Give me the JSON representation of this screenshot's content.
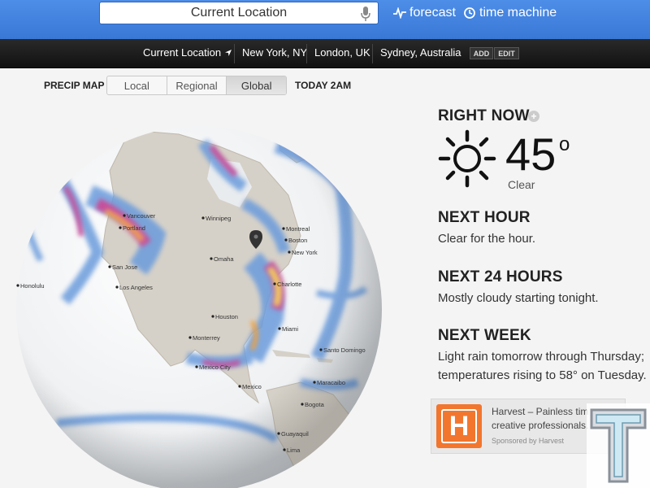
{
  "search": {
    "value": "Current Location"
  },
  "nav": {
    "forecast": "forecast",
    "time_machine": "time machine"
  },
  "locations": {
    "items": [
      "Current Location",
      "New York, NY",
      "London, UK",
      "Sydney, Australia"
    ],
    "add": "ADD",
    "edit": "EDIT"
  },
  "precip": {
    "label": "PRECIP MAP",
    "tabs": [
      "Local",
      "Regional",
      "Global"
    ],
    "active": "Global",
    "time": "TODAY 2AM"
  },
  "map": {
    "cities": [
      "Vancouver",
      "Portland",
      "Winnipeg",
      "Montreal",
      "Boston",
      "New York",
      "Omaha",
      "San Jose",
      "Los Angeles",
      "Honolulu",
      "Charlotte",
      "Houston",
      "Miami",
      "Monterrey",
      "Santo Domingo",
      "Mexico City",
      "Mexico",
      "Maracaibo",
      "Bogota",
      "Guayaquil",
      "Lima"
    ]
  },
  "weather": {
    "right_now": "RIGHT NOW",
    "temp": "45",
    "deg": "o",
    "cond": "Clear",
    "next_hour_title": "NEXT HOUR",
    "next_hour_text": "Clear for the hour.",
    "next_24_title": "NEXT 24 HOURS",
    "next_24_text": "Mostly cloudy starting tonight.",
    "next_week_title": "NEXT WEEK",
    "next_week_line1": "Light rain tomorrow through Thursday;",
    "next_week_line2": "temperatures rising to 58° on Tuesday."
  },
  "ad": {
    "letter": "H",
    "line1": "Harvest – Painless tim",
    "line2": "creative professionals.",
    "sponsor": "Sponsored by Harvest"
  },
  "colors": {
    "accent": "#3a78d6",
    "ad_orange": "#f2762e"
  }
}
